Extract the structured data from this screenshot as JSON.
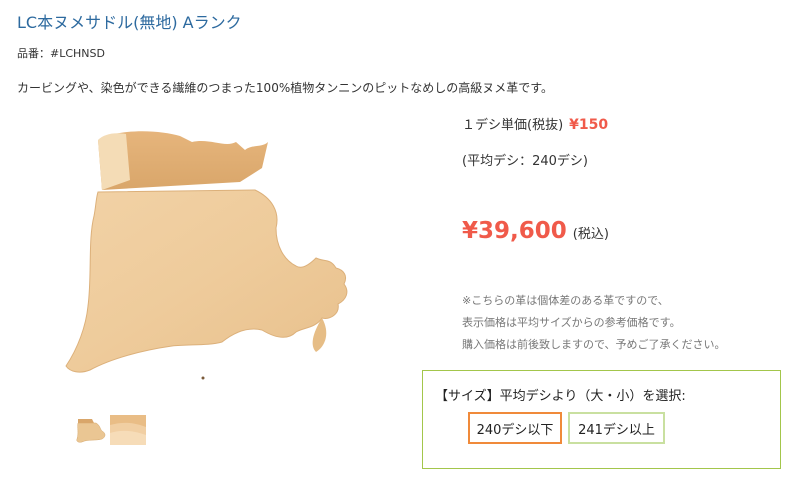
{
  "product": {
    "title": "LC本ヌメサドル(無地) Aランク",
    "sku": "品番：#LCHNSD",
    "description": "カービングや、染色ができる繊維のつまった100%植物タンニンのピットなめしの高級ヌメ革です。"
  },
  "pricing": {
    "unit_label": "１デシ単価(税抜)",
    "unit_price": "¥150",
    "average": "(平均デシ：240デシ)",
    "price": "¥39,600",
    "tax_label": "(税込)"
  },
  "notes": [
    "※こちらの革は個体差のある革ですので、",
    "表示価格は平均サイズからの参考価格です。",
    "購入価格は前後致しますので、予めご了承ください。"
  ],
  "size_select": {
    "label": "【サイズ】平均デシより（大・小）を選択:",
    "options": [
      "240デシ以下",
      "241デシ以上"
    ],
    "selected_index": 0
  },
  "colors": {
    "title": "#2d6a9f",
    "price": "#f05a4a",
    "selected_border": "#f08a3a",
    "box_border": "#a3c64b"
  },
  "icons": {
    "main_image": "leather-hide-image",
    "thumb1": "leather-hide-thumbnail",
    "thumb2": "leather-closeup-thumbnail"
  }
}
